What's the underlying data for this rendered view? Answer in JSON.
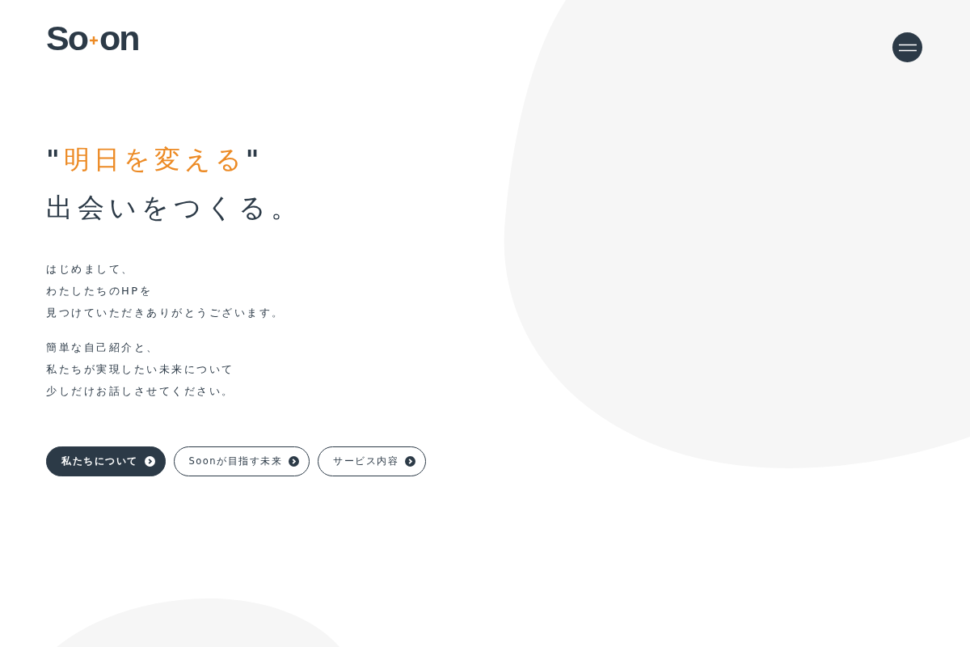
{
  "logo": {
    "left": "So",
    "right": "on"
  },
  "headline": {
    "open": "\"",
    "accent": "明日を変える",
    "close": "\"",
    "second": "出会いをつくる。"
  },
  "paragraphs": [
    [
      "はじめまして、",
      "わたしたちのHPを",
      "見つけていただきありがとうございます。"
    ],
    [
      "簡単な自己紹介と、",
      "私たちが実現したい未来について",
      "少しだけお話しさせてください。"
    ]
  ],
  "buttons": [
    {
      "label": "私たちについて",
      "kind": "primary"
    },
    {
      "label": "Soonが目指す未来",
      "kind": "outline"
    },
    {
      "label": "サービス内容",
      "kind": "outline"
    }
  ]
}
